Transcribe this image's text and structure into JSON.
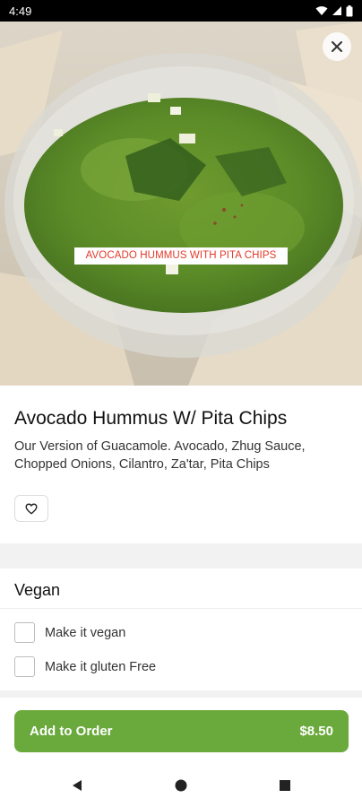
{
  "status_bar": {
    "time": "4:49"
  },
  "hero": {
    "caption": "AVOCADO HUMMUS WITH PITA CHIPS"
  },
  "item": {
    "title": "Avocado Hummus W/ Pita Chips",
    "description": "Our Version of Guacamole.  Avocado, Zhug Sauce, Chopped Onions, Cilantro, Za'tar, Pita Chips"
  },
  "options_section": {
    "title": "Vegan",
    "options": [
      {
        "label": "Make it vegan",
        "checked": false
      },
      {
        "label": "Make it gluten Free",
        "checked": false
      }
    ]
  },
  "add_to_order": {
    "label": "Add to Order",
    "price": "$8.50"
  },
  "colors": {
    "accent": "#6aa93b",
    "caption_text": "#e23b2a"
  },
  "icons": {
    "close": "close-icon",
    "favorite": "heart-outline-icon",
    "back": "nav-back-icon",
    "home": "nav-home-icon",
    "recents": "nav-recents-icon"
  }
}
